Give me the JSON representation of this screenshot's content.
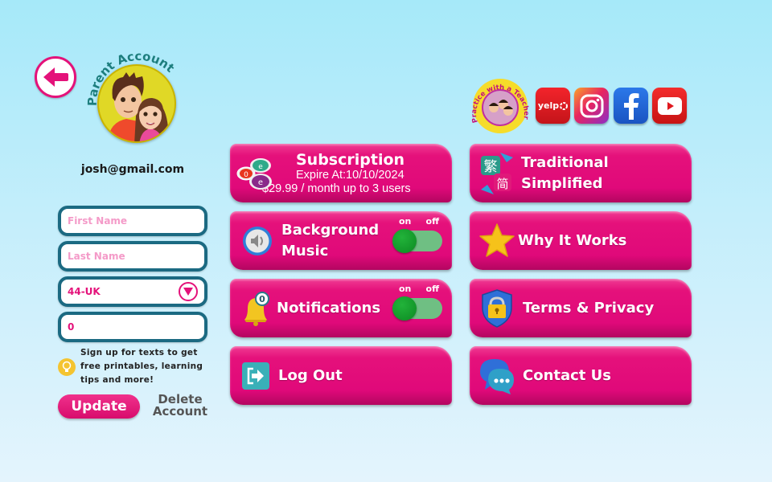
{
  "header": {
    "back_label": "Back",
    "account_title": "Parent Account",
    "email": "josh@gmail.com"
  },
  "form": {
    "first_name": {
      "value": "",
      "placeholder": "First Name"
    },
    "last_name": {
      "value": "",
      "placeholder": "Last Name"
    },
    "country_code": {
      "selected": "44-UK"
    },
    "phone": {
      "value": "0",
      "placeholder": ""
    },
    "sms_tip": "Sign up for texts to get free printables, learning tips and more!",
    "update_label": "Update",
    "delete_label_line1": "Delete",
    "delete_label_line2": "Account"
  },
  "social": {
    "teacher_badge": "Practice with a Teacher",
    "yelp_label": "yelp",
    "links": [
      "yelp",
      "instagram",
      "facebook",
      "youtube"
    ]
  },
  "menu": {
    "subscription": {
      "title": "Subscription",
      "expire": "Expire At:10/10/2024",
      "price": "$29.99 / month up to 3 users"
    },
    "background_music": {
      "line1": "Background",
      "line2": "Music",
      "toggle_on": "on",
      "toggle_off": "off",
      "state": "on"
    },
    "notifications": {
      "label": "Notifications",
      "badge_count": "0",
      "toggle_on": "on",
      "toggle_off": "off",
      "state": "on"
    },
    "log_out": {
      "label": "Log Out"
    },
    "traditional_simplified": {
      "line1": "Traditional",
      "line2": "Simplified",
      "trad_char": "繁",
      "simp_char": "简"
    },
    "why_it_works": {
      "label": "Why It Works"
    },
    "terms_privacy": {
      "label": "Terms & Privacy"
    },
    "contact_us": {
      "label": "Contact Us"
    }
  },
  "colors": {
    "brand_pink": "#e4127a",
    "field_border": "#1b6a82",
    "toggle_green": "#0c8a22",
    "bg_top": "#a6e9f9",
    "bg_bottom": "#e4f4fd"
  }
}
